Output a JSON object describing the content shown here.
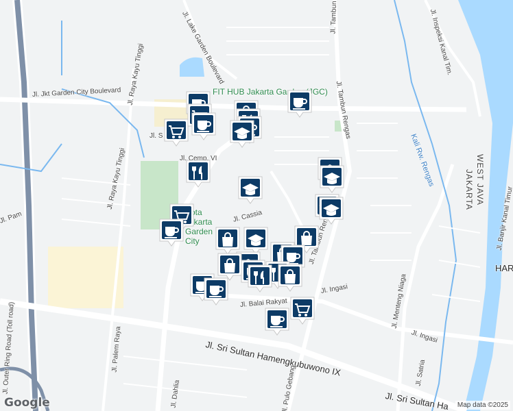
{
  "map": {
    "streets": [
      {
        "id": "outer-ring",
        "text": "Jl. Outer Ring Road (Toll road)"
      },
      {
        "id": "lake-garden",
        "text": "Jl. Lake Garden Boulevard"
      },
      {
        "id": "jkt-garden",
        "text": "Jl. Jkt Garden City Boulevard"
      },
      {
        "id": "raya-kayu-tinggi",
        "text": "Jl. Raya Kayu Tinggi"
      },
      {
        "id": "raya-kayu-tinggi-2",
        "text": "Jl. Raya Kayu Tinggi"
      },
      {
        "id": "cemp",
        "text": "Jl. Cemp. VI"
      },
      {
        "id": "cassia",
        "text": "Jl. Cassia"
      },
      {
        "id": "tambun-utara",
        "text": "Jl. Tambun Utara"
      },
      {
        "id": "tambun-rengas",
        "text": "Jl. Tambun Rengas"
      },
      {
        "id": "tambun-rengas-2",
        "text": "Jl. Tambun Rengas"
      },
      {
        "id": "balai-rakyat",
        "text": "Jl. Balai Rakyat"
      },
      {
        "id": "ingasi",
        "text": "Jl. Ingasi"
      },
      {
        "id": "ingasi-2",
        "text": "Jl. Ingasi"
      },
      {
        "id": "sri-sultan",
        "text": "Jl. Sri Sultan Hamengkubuwono IX"
      },
      {
        "id": "sri-sultan-2",
        "text": "Jl. Sri Sultan Ha"
      },
      {
        "id": "palem-raya",
        "text": "Jl. Palem Raya"
      },
      {
        "id": "dahlia",
        "text": "Jl. Dahlia"
      },
      {
        "id": "menteng-niaga",
        "text": "Jl. Menteng Niaga"
      },
      {
        "id": "satria",
        "text": "Jl. Satria"
      },
      {
        "id": "inspeksi",
        "text": "Jl. Inspeksi Kanal Tim."
      },
      {
        "id": "banjir-kanal",
        "text": "Jl. Banjir Kanal Timur"
      },
      {
        "id": "pam",
        "text": "Jl. Pam"
      },
      {
        "id": "pulo-gebang",
        "text": "Jl. Pulo Gebang"
      },
      {
        "id": "cemp-s",
        "text": "Jl. S"
      }
    ],
    "places": [
      {
        "id": "fit-hub",
        "text": "FIT HUB Jakarta Garden (JGC)"
      },
      {
        "id": "kota-garden",
        "text": "Kota Jakarta Garden City"
      },
      {
        "id": "kali-rw",
        "text": "Kali Rw. Rengas"
      },
      {
        "id": "west-java",
        "text": "WEST JAVA"
      },
      {
        "id": "jakarta",
        "text": "JAKARTA"
      },
      {
        "id": "harapan",
        "text": "HARAP"
      }
    ],
    "markers": [
      {
        "type": "coffee",
        "label": "coffee-marker"
      },
      {
        "type": "shopping",
        "label": "shopping-marker"
      },
      {
        "type": "school",
        "label": "school-marker"
      },
      {
        "type": "restaurant",
        "label": "restaurant-marker"
      }
    ],
    "colors": {
      "marker": "#0d3b66",
      "road": "#ffffff",
      "water": "#aadaff",
      "green": "#c8e6c9",
      "river": "#7ab8ef"
    },
    "attribution": "Map data ©2025",
    "logo": "Google"
  }
}
